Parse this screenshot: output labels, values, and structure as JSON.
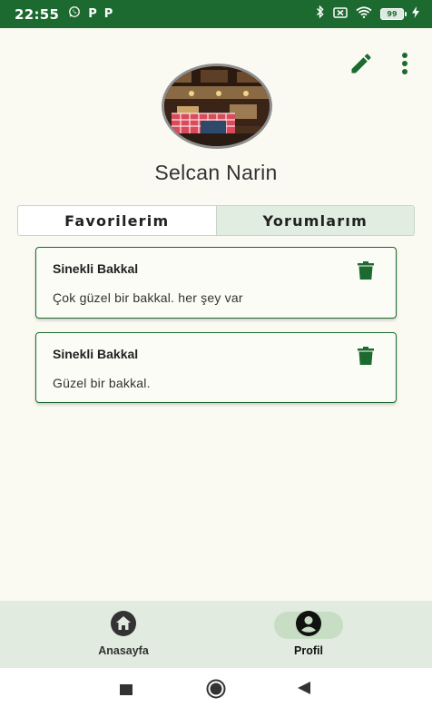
{
  "status_bar": {
    "time": "22:55",
    "left_icons": [
      "whatsapp-icon",
      "p-notification-icon",
      "p-notification-icon"
    ],
    "p_glyph": "P",
    "right_icons": [
      "bluetooth-icon",
      "sim-off-icon",
      "wifi-icon",
      "battery-icon",
      "charging-icon"
    ],
    "battery_level": "99"
  },
  "header": {
    "actions": [
      "edit-icon",
      "more-vert-icon"
    ]
  },
  "profile": {
    "name": "Selcan Narin"
  },
  "tabs": [
    {
      "label": "Favorilerim",
      "active": false
    },
    {
      "label": "Yorumlarım",
      "active": true
    }
  ],
  "comments": [
    {
      "title": "Sinekli Bakkal",
      "text": "Çok güzel bir bakkal. her şey var"
    },
    {
      "title": "Sinekli Bakkal",
      "text": "Güzel bir bakkal."
    }
  ],
  "bottom_nav": {
    "items": [
      {
        "label": "Anasayfa",
        "icon": "home-icon",
        "active": false
      },
      {
        "label": "Profil",
        "icon": "account-circle-icon",
        "active": true
      }
    ]
  },
  "colors": {
    "primary": "#1c6a2f",
    "background": "#fafaf3",
    "tab_active": "#e1ede0",
    "nav_background": "#e1ebdf",
    "nav_active_pill": "#c7dec5"
  }
}
